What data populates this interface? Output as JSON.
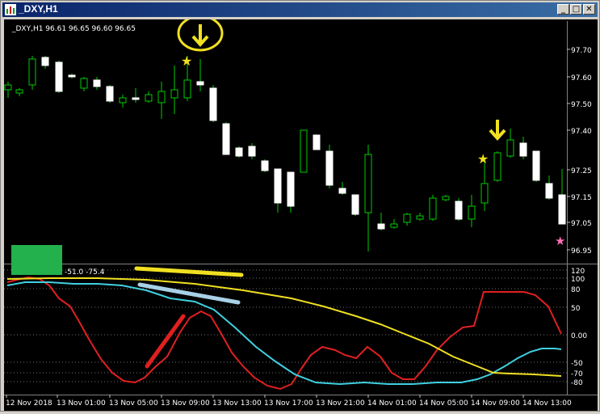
{
  "window": {
    "title": "_DXY,H1",
    "min_label": "_",
    "max_label": "□",
    "close_label": "✕"
  },
  "chart": {
    "info_label": "_DXY,H1  96.61 96.65 96.60 96.65",
    "indicator_label": "-51.0 -75.4",
    "colors": {
      "background": "#000000",
      "bull_candle": "#000000",
      "bear_candle": "#ffffff",
      "wick": "#00cc00",
      "grid": "#707070",
      "red_line": "#e02020",
      "cyan_line": "#40d0e0",
      "yellow_line": "#f0e020",
      "green_box": "#22b14c",
      "annotation_yellow": "#f0e020",
      "annotation_blue": "#a8d0e6",
      "pink_star": "#ff6eb4"
    },
    "price_axis": [
      "97.70",
      "97.60",
      "97.50",
      "97.40",
      "97.25",
      "97.15",
      "97.05",
      "96.95"
    ],
    "indicator_axis": [
      "120",
      "100",
      "80",
      "50",
      "0.00",
      "-50",
      "-70",
      "-80"
    ],
    "time_axis": [
      "12 Nov 2018",
      "13 Nov 01:00",
      "13 Nov 05:00",
      "13 Nov 09:00",
      "13 Nov 13:00",
      "13 Nov 17:00",
      "13 Nov 21:00",
      "14 Nov 01:00",
      "14 Nov 05:00",
      "14 Nov 09:00",
      "14 Nov 13:00"
    ]
  }
}
